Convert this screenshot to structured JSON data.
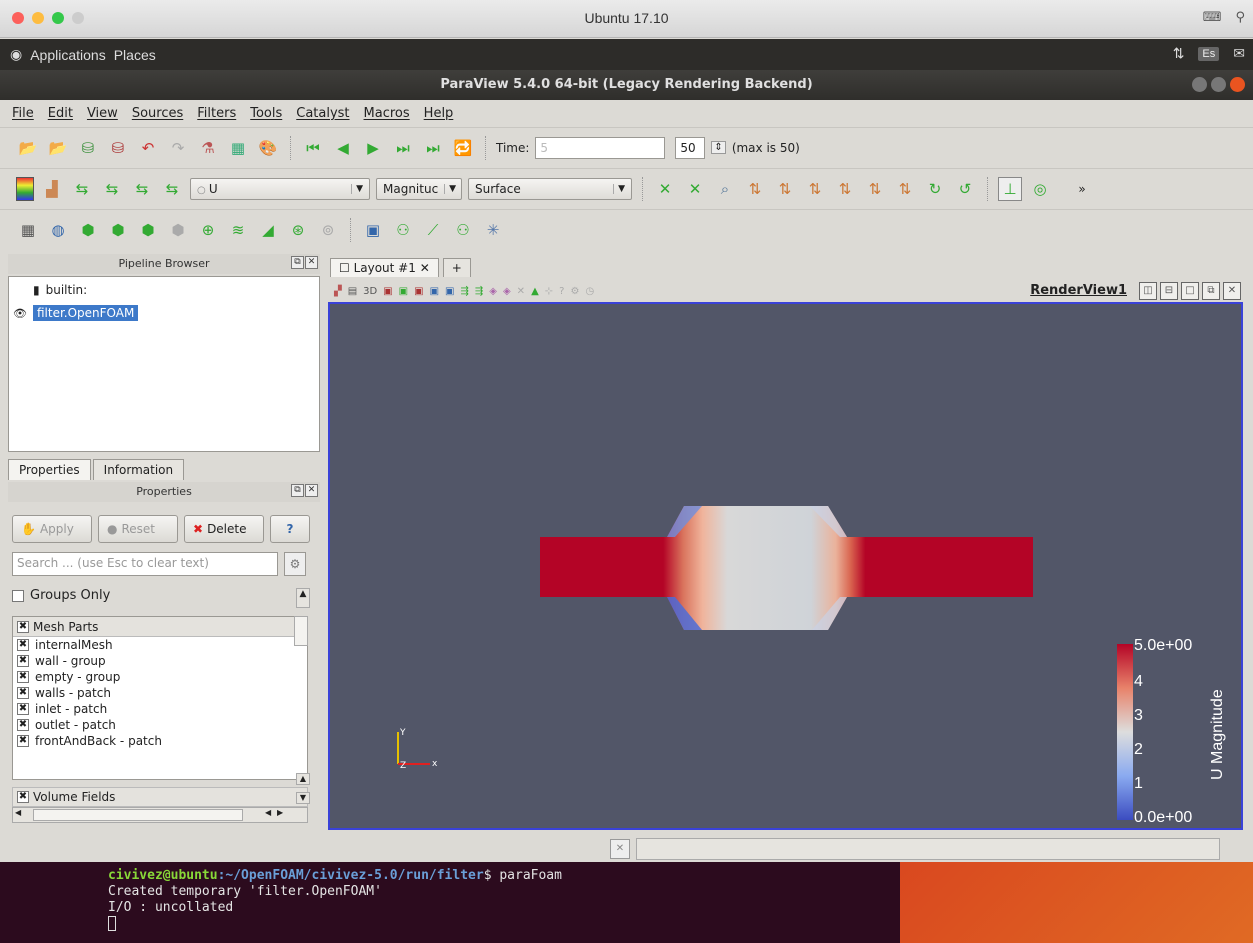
{
  "mac": {
    "title": "Ubuntu 17.10"
  },
  "ubuntu_panel": {
    "applications": "Applications",
    "places": "Places",
    "keyboard_badge": "Es"
  },
  "app": {
    "title": "ParaView 5.4.0 64-bit (Legacy Rendering Backend)"
  },
  "menu": [
    "File",
    "Edit",
    "View",
    "Sources",
    "Filters",
    "Tools",
    "Catalyst",
    "Macros",
    "Help"
  ],
  "time_toolbar": {
    "time_label": "Time:",
    "time_value": "5",
    "step_value": "50",
    "max_text": "(max is 50)"
  },
  "display_toolbar": {
    "array_select": "U",
    "component_select": "Magnituc",
    "representation_select": "Surface",
    "more": "»"
  },
  "pipeline": {
    "title": "Pipeline Browser",
    "root": "builtin:",
    "items": [
      "filter.OpenFOAM"
    ]
  },
  "panel_tabs": [
    "Properties",
    "Information"
  ],
  "properties": {
    "title": "Properties",
    "apply": "Apply",
    "reset": "Reset",
    "delete": "Delete",
    "help": "?",
    "search_placeholder": "Search ... (use Esc to clear text)",
    "groups_only": "Groups Only",
    "mesh_parts_header": "Mesh Parts",
    "mesh_parts": [
      "internalMesh",
      "wall - group",
      "empty - group",
      "walls - patch",
      "inlet - patch",
      "outlet - patch",
      "frontAndBack - patch"
    ],
    "volume_fields_header": "Volume Fields"
  },
  "layout": {
    "tab": "Layout #1",
    "add_tab": "+",
    "view_name": "RenderView1",
    "view_toolbar_text": "3D"
  },
  "render": {
    "background": "#525668",
    "scalar_bar": {
      "title": "U Magnitude",
      "labels": [
        "5.0e+00",
        "4",
        "3",
        "2",
        "1",
        "0.0e+00"
      ]
    },
    "axes": {
      "x": "x",
      "y": "Y",
      "z": "Z"
    }
  },
  "terminal": {
    "user_host": "civivez@ubuntu",
    "path": ":~/OpenFOAM/civivez-5.0/run/filter",
    "command": "$ paraFoam",
    "line2": "Created temporary 'filter.OpenFOAM'",
    "line3": "I/O    : uncollated"
  }
}
